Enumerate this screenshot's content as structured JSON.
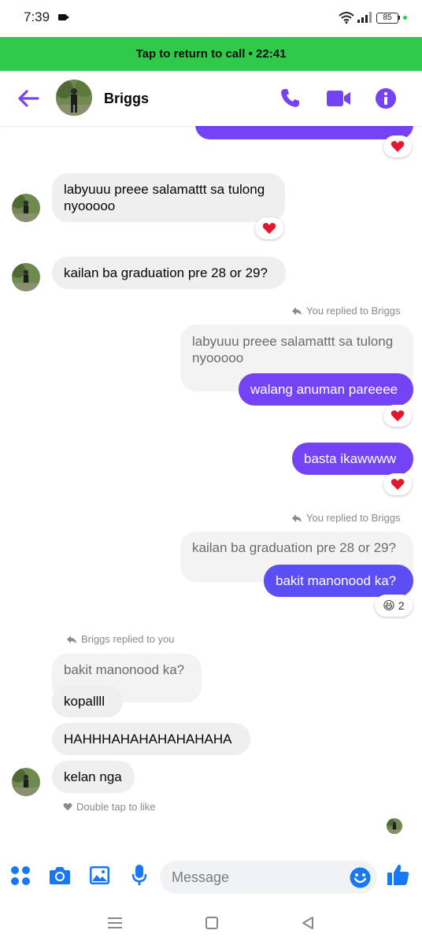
{
  "status_bar": {
    "time": "7:39",
    "battery": "85"
  },
  "call_banner": {
    "text": "Tap to return to call • 22:41"
  },
  "header": {
    "contact_name": "Briggs"
  },
  "messages": {
    "m1_text": "labyuuu preee salamattt sa tulong nyooooo",
    "m2_text": "kailan ba graduation pre 28 or 29?",
    "reply1_note": "You replied to Briggs",
    "reply1_quote": "labyuuu preee salamattt sa tulong nyooooo",
    "m3_text": "walang anuman pareeee",
    "m4_text": "basta ikawwww",
    "reply2_note": "You replied to Briggs",
    "reply2_quote": "kailan ba graduation pre 28 or 29?",
    "m5_text": "bakit manonood ka?",
    "m5_reaction_count": "2",
    "reply3_note": "Briggs replied to you",
    "reply3_quote": "bakit manonood ka?",
    "m6_text": "kopallll",
    "m7_text": "HAHHHAHAHAHAHAHAHA",
    "m8_text": "kelan nga",
    "double_tap": "Double tap to like"
  },
  "composer": {
    "placeholder": "Message"
  },
  "colors": {
    "accent": "#7443f5",
    "call_green": "#31c94a",
    "messenger_blue": "#1877f2"
  },
  "icons": [
    "back-arrow-icon",
    "phone-icon",
    "video-icon",
    "info-icon",
    "apps-icon",
    "camera-icon",
    "gallery-icon",
    "mic-icon",
    "emoji-icon",
    "like-icon",
    "reply-icon",
    "heart-icon"
  ]
}
